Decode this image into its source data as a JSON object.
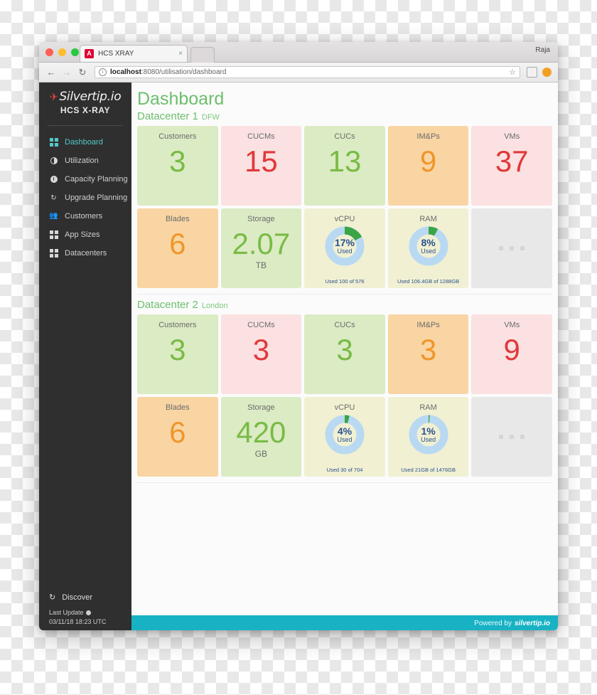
{
  "browser": {
    "tab_title": "HCS XRAY",
    "tab_favicon": "angular-icon",
    "tab_close": "×",
    "user_label": "Raja",
    "back": "←",
    "forward": "→",
    "reload": "↻",
    "url_host": "localhost",
    "url_path": ":8080/utilisation/dashboard",
    "star": "☆"
  },
  "sidebar": {
    "logo_name": "Silvertip.io",
    "logo_sub": "HCS X-RAY",
    "items": [
      {
        "label": "Dashboard",
        "icon": "grid-icon",
        "active": true
      },
      {
        "label": "Utilization",
        "icon": "pie-icon",
        "active": false
      },
      {
        "label": "Capacity Planning",
        "icon": "info-circle-icon",
        "active": false
      },
      {
        "label": "Upgrade Planning",
        "icon": "refresh-icon",
        "active": false
      },
      {
        "label": "Customers",
        "icon": "people-icon",
        "active": false
      },
      {
        "label": "App Sizes",
        "icon": "grid-icon",
        "active": false
      },
      {
        "label": "Datacenters",
        "icon": "grid-icon",
        "active": false
      }
    ],
    "discover": "Discover",
    "last_update_label": "Last Update",
    "last_update_value": "03/11/18 18:23 UTC"
  },
  "main": {
    "page_title": "Dashboard",
    "footer_powered": "Powered by",
    "footer_brand": "silvertip.io"
  },
  "datacenters": [
    {
      "name": "Datacenter 1",
      "location": "DFW",
      "row1": [
        {
          "label": "Customers",
          "value": "3",
          "bg": "c-green",
          "color": "v-green"
        },
        {
          "label": "CUCMs",
          "value": "15",
          "bg": "c-pink",
          "color": "v-red"
        },
        {
          "label": "CUCs",
          "value": "13",
          "bg": "c-green",
          "color": "v-green"
        },
        {
          "label": "IM&Ps",
          "value": "9",
          "bg": "c-orange",
          "color": "v-orange"
        },
        {
          "label": "VMs",
          "value": "37",
          "bg": "c-pink",
          "color": "v-red"
        }
      ],
      "row2": {
        "blades": {
          "label": "Blades",
          "value": "6",
          "bg": "c-orange",
          "color": "v-orange"
        },
        "storage": {
          "label": "Storage",
          "value": "2.07",
          "unit": "TB",
          "bg": "c-green",
          "color": "v-green"
        },
        "vcpu": {
          "label": "vCPU",
          "percent": 17,
          "pct_text": "17%",
          "used_text": "Used",
          "caption": "Used 100 of 576"
        },
        "ram": {
          "label": "RAM",
          "percent": 8,
          "pct_text": "8%",
          "used_text": "Used",
          "caption": "Used 106.4GB of 1288GB"
        },
        "empty": {
          "label": "placeholder"
        }
      }
    },
    {
      "name": "Datacenter 2",
      "location": "London",
      "row1": [
        {
          "label": "Customers",
          "value": "3",
          "bg": "c-green",
          "color": "v-green"
        },
        {
          "label": "CUCMs",
          "value": "3",
          "bg": "c-pink",
          "color": "v-red"
        },
        {
          "label": "CUCs",
          "value": "3",
          "bg": "c-green",
          "color": "v-green"
        },
        {
          "label": "IM&Ps",
          "value": "3",
          "bg": "c-orange",
          "color": "v-orange"
        },
        {
          "label": "VMs",
          "value": "9",
          "bg": "c-pink",
          "color": "v-red"
        }
      ],
      "row2": {
        "blades": {
          "label": "Blades",
          "value": "6",
          "bg": "c-orange",
          "color": "v-orange"
        },
        "storage": {
          "label": "Storage",
          "value": "420",
          "unit": "GB",
          "bg": "c-green",
          "color": "v-green"
        },
        "vcpu": {
          "label": "vCPU",
          "percent": 4,
          "pct_text": "4%",
          "used_text": "Used",
          "caption": "Used 30 of 704"
        },
        "ram": {
          "label": "RAM",
          "percent": 1,
          "pct_text": "1%",
          "used_text": "Used",
          "caption": "Used 21GB of 1476GB"
        },
        "empty": {
          "label": "placeholder"
        }
      }
    }
  ],
  "colors": {
    "accent_teal": "#18b2c4",
    "green": "#79bb45",
    "red": "#e1383a",
    "orange": "#f0962a",
    "donut_track": "#b9d9f2",
    "donut_fill": "#3ba447",
    "donut_text": "#29518e",
    "sidebar_bg": "#2f2f2f",
    "sidebar_active": "#54c8c8"
  }
}
